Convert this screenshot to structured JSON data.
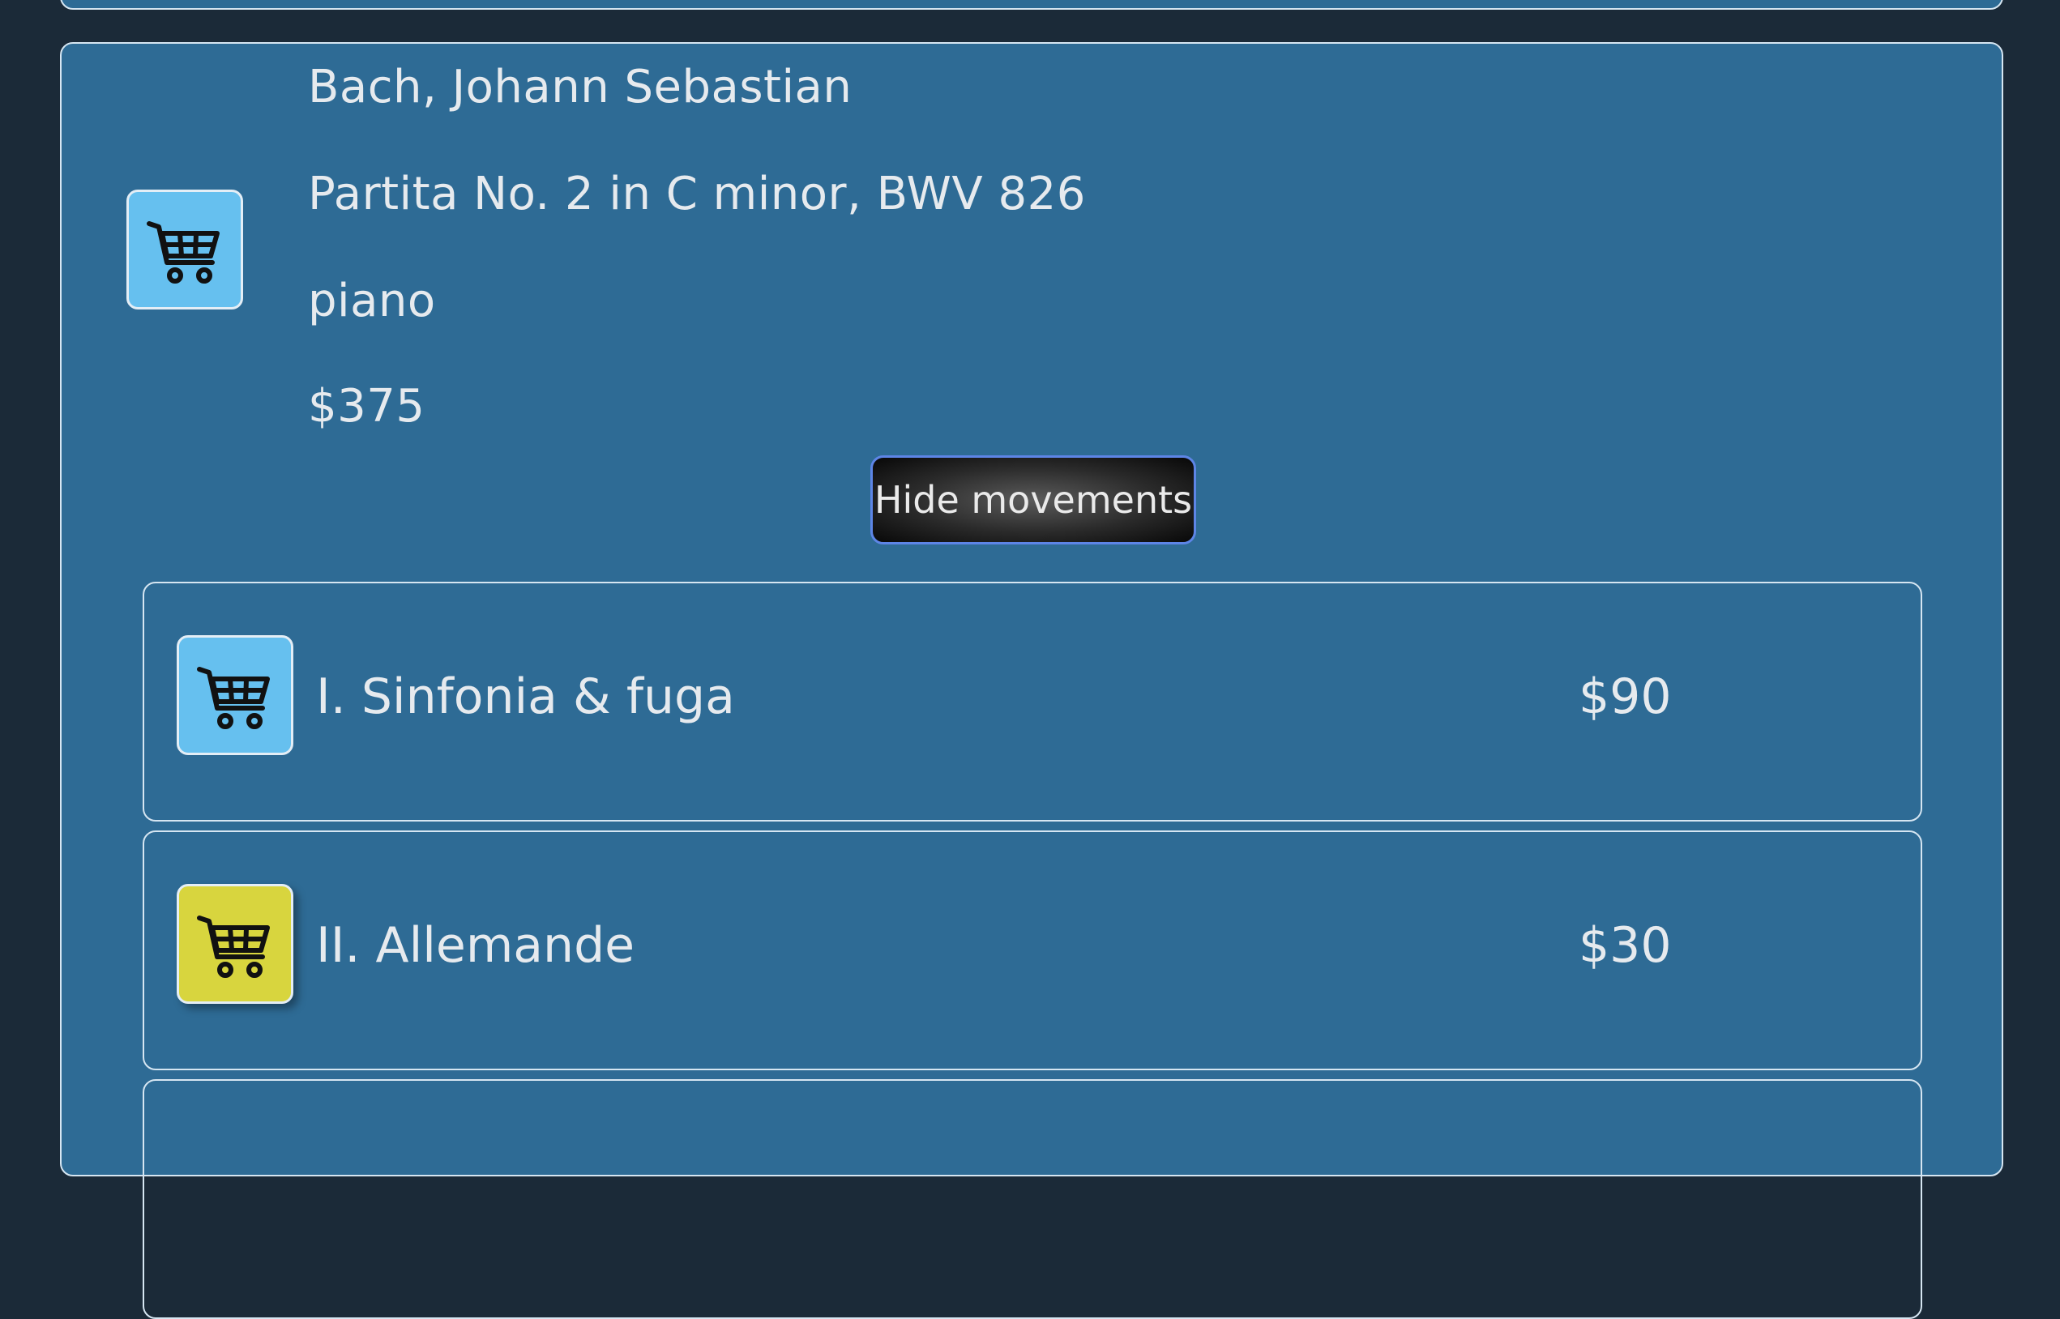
{
  "piece": {
    "composer": "Bach, Johann Sebastian",
    "title": "Partita No. 2 in C minor, BWV 826",
    "instrument": "piano",
    "price": "$375",
    "cart_icon": "shopping-cart-icon",
    "toggle_label": "Hide movements"
  },
  "movements": [
    {
      "title": "I. Sinfonia & fuga",
      "price": "$90",
      "cart_state": "not-in-cart",
      "cart_color": "#66c0ef"
    },
    {
      "title": "II. Allemande",
      "price": "$30",
      "cart_state": "in-cart",
      "cart_color": "#d8d53e"
    }
  ],
  "colors": {
    "page_background": "#1b2a38",
    "card_background": "#2e6b95",
    "cart_default": "#66c0ef",
    "cart_selected": "#d8d53e"
  }
}
